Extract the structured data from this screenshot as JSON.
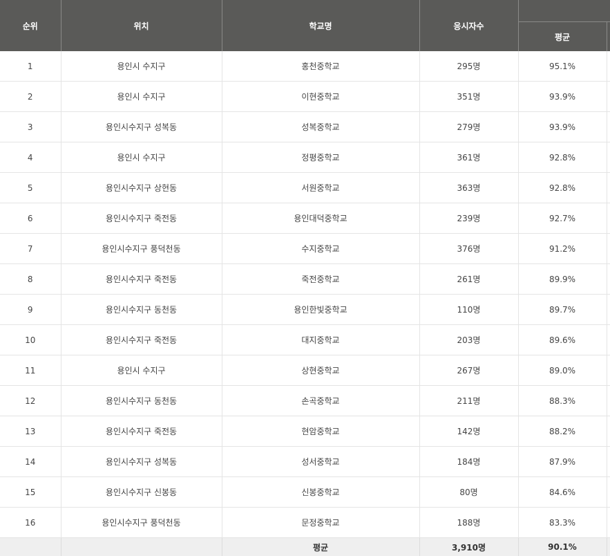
{
  "headers": {
    "rank": "순위",
    "location": "위치",
    "school": "학교명",
    "examinees": "응시자수",
    "average": "평균"
  },
  "rows": [
    {
      "rank": "1",
      "location": "용인시 수지구",
      "school": "홍천중학교",
      "examinees": "295명",
      "average": "95.1%"
    },
    {
      "rank": "2",
      "location": "용인시 수지구",
      "school": "이현중학교",
      "examinees": "351명",
      "average": "93.9%"
    },
    {
      "rank": "3",
      "location": "용인시수지구 성복동",
      "school": "성복중학교",
      "examinees": "279명",
      "average": "93.9%"
    },
    {
      "rank": "4",
      "location": "용인시 수지구",
      "school": "정평중학교",
      "examinees": "361명",
      "average": "92.8%"
    },
    {
      "rank": "5",
      "location": "용인시수지구 상현동",
      "school": "서원중학교",
      "examinees": "363명",
      "average": "92.8%"
    },
    {
      "rank": "6",
      "location": "용인시수지구 죽전동",
      "school": "용인대덕중학교",
      "examinees": "239명",
      "average": "92.7%"
    },
    {
      "rank": "7",
      "location": "용인시수지구 풍덕천동",
      "school": "수지중학교",
      "examinees": "376명",
      "average": "91.2%"
    },
    {
      "rank": "8",
      "location": "용인시수지구 죽전동",
      "school": "죽전중학교",
      "examinees": "261명",
      "average": "89.9%"
    },
    {
      "rank": "9",
      "location": "용인시수지구 동천동",
      "school": "용인한빛중학교",
      "examinees": "110명",
      "average": "89.7%"
    },
    {
      "rank": "10",
      "location": "용인시수지구 죽전동",
      "school": "대지중학교",
      "examinees": "203명",
      "average": "89.6%"
    },
    {
      "rank": "11",
      "location": "용인시 수지구",
      "school": "상현중학교",
      "examinees": "267명",
      "average": "89.0%"
    },
    {
      "rank": "12",
      "location": "용인시수지구 동천동",
      "school": "손곡중학교",
      "examinees": "211명",
      "average": "88.3%"
    },
    {
      "rank": "13",
      "location": "용인시수지구 죽전동",
      "school": "현암중학교",
      "examinees": "142명",
      "average": "88.2%"
    },
    {
      "rank": "14",
      "location": "용인시수지구 성복동",
      "school": "성서중학교",
      "examinees": "184명",
      "average": "87.9%"
    },
    {
      "rank": "15",
      "location": "용인시수지구 신봉동",
      "school": "신봉중학교",
      "examinees": "80명",
      "average": "84.6%"
    },
    {
      "rank": "16",
      "location": "용인시수지구 풍덕천동",
      "school": "문정중학교",
      "examinees": "188명",
      "average": "83.3%"
    }
  ],
  "footer": {
    "label": "평균",
    "examinees": "3,910명",
    "average": "90.1%"
  }
}
